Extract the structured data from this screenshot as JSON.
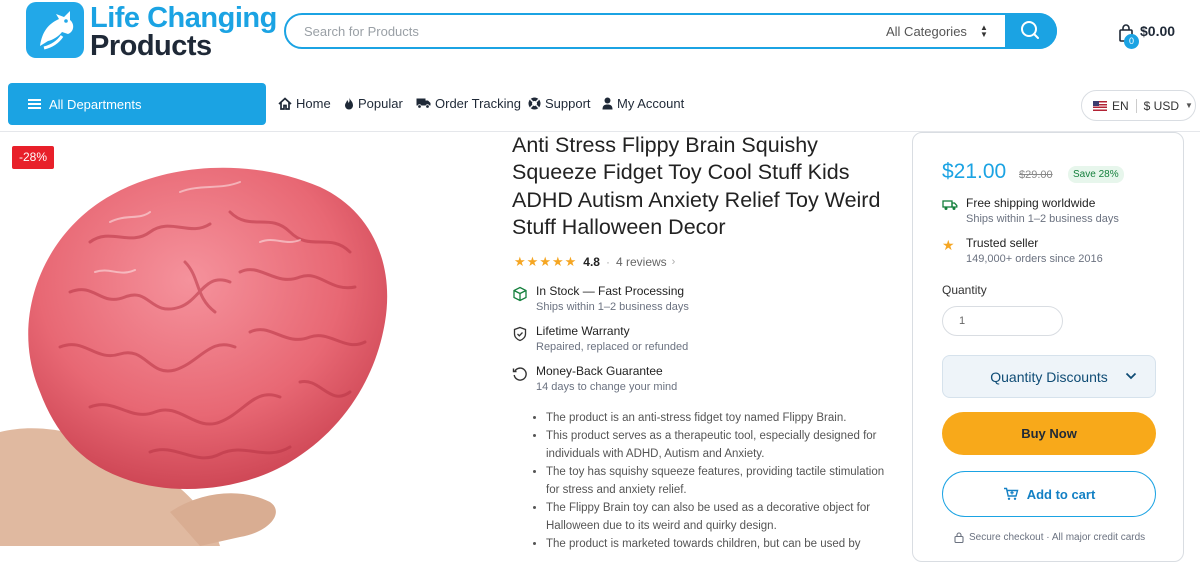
{
  "brand": {
    "line1": "Life Changing",
    "line2": "Products"
  },
  "search": {
    "placeholder": "Search for Products",
    "category": "All Categories"
  },
  "cart": {
    "count": "0",
    "total": "$0.00"
  },
  "nav": {
    "departments": "All Departments",
    "items": [
      "Home",
      "Popular",
      "Order Tracking",
      "Support",
      "My Account"
    ]
  },
  "locale": {
    "language": "EN",
    "currency": "$ USD"
  },
  "product": {
    "discount_badge": "-28%",
    "title": "Anti Stress Flippy Brain Squishy Squeeze Fidget Toy Cool Stuff Kids ADHD Autism Anxiety Relief Toy Weird Stuff Halloween Decor",
    "rating": "4.8",
    "stars": 5,
    "reviews": "4 reviews",
    "features": [
      {
        "title": "In Stock — Fast Processing",
        "sub": "Ships within 1–2 business days"
      },
      {
        "title": "Lifetime Warranty",
        "sub": "Repaired, replaced or refunded"
      },
      {
        "title": "Money-Back Guarantee",
        "sub": "14 days to change your mind"
      }
    ],
    "bullets": [
      "The product is an anti-stress fidget toy named Flippy Brain.",
      "This product serves as a therapeutic tool, especially designed for individuals with ADHD, Autism and Anxiety.",
      "The toy has squishy squeeze features, providing tactile stimulation for stress and anxiety relief.",
      "The Flippy Brain toy can also be used as a decorative object for Halloween due to its weird and quirky design.",
      "The product is marketed towards children, but can be used by"
    ]
  },
  "buybox": {
    "price": "$21.00",
    "old_price": "$29.00",
    "save": "Save 28%",
    "perks": [
      {
        "title": "Free shipping worldwide",
        "sub": "Ships within 1–2 business days"
      },
      {
        "title": "Trusted seller",
        "sub": "149,000+ orders since 2016"
      }
    ],
    "quantity_label": "Quantity",
    "quantity_value": "1",
    "quantity_discounts": "Quantity Discounts",
    "buy_now": "Buy Now",
    "add_to_cart": "Add to cart",
    "secure": "Secure checkout · All major credit cards"
  },
  "colors": {
    "accent": "#1ba3e3",
    "buy": "#f8a91a",
    "sale": "#e8202a",
    "star": "#f5a623",
    "success": "#15803d"
  }
}
